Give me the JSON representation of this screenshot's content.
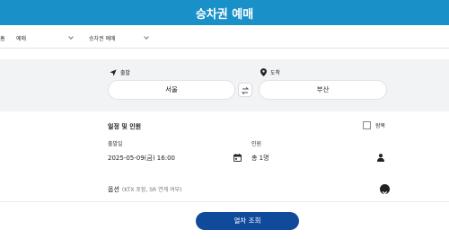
{
  "header": {
    "title": "승차권 예매"
  },
  "breadcrumb": {
    "home_fragment": "홈",
    "level1": "예매",
    "level2": "승차권 예매"
  },
  "stations": {
    "departure_label": "출발",
    "departure_value": "서울",
    "arrival_label": "도착",
    "arrival_value": "부산"
  },
  "schedule": {
    "section_title": "일정 및 인원",
    "roundtrip_label": "왕복",
    "date_label": "출발일",
    "date_value": "2025-05-09(금) 16:00",
    "passenger_label": "인원",
    "passenger_value": "총 1명"
  },
  "options": {
    "label": "옵션",
    "note": "(KTX 포함, SR 연계 여부)"
  },
  "search_button": "열차 조회",
  "colors": {
    "header": "#1a90c9",
    "primary_button": "#0f4a9b",
    "band": "#f2f3f5"
  }
}
